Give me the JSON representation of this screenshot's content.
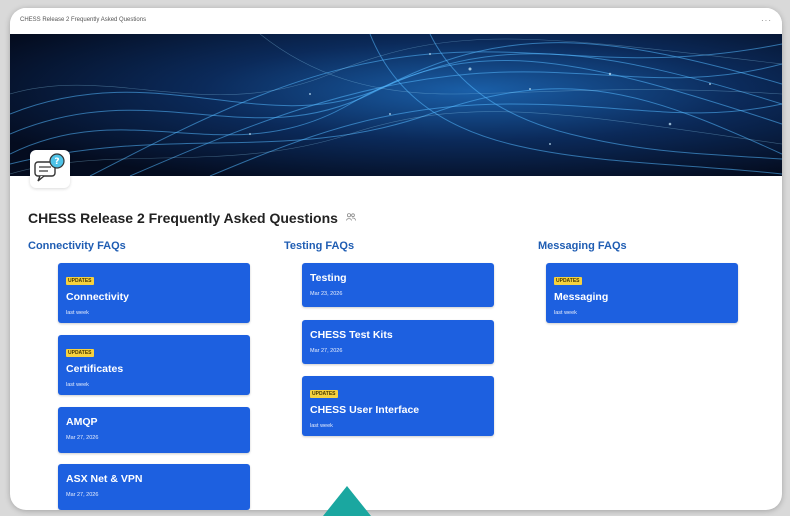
{
  "topbar": {
    "breadcrumb": "CHESS Release 2 Frequently Asked Questions",
    "more_label": "···"
  },
  "page": {
    "title": "CHESS Release 2 Frequently Asked Questions",
    "title_icon": "people-icon",
    "page_icon": "chat-question-icon"
  },
  "columns": [
    {
      "heading": "Connectivity FAQs",
      "cards": [
        {
          "badge": "UPDATES",
          "title": "Connectivity",
          "date": "last week"
        },
        {
          "badge": "UPDATES",
          "title": "Certificates",
          "date": "last week"
        },
        {
          "badge": "",
          "title": "AMQP",
          "date": "Mar 27, 2026"
        },
        {
          "badge": "",
          "title": "ASX Net & VPN",
          "date": "Mar 27, 2026"
        }
      ]
    },
    {
      "heading": "Testing FAQs",
      "cards": [
        {
          "badge": "",
          "title": "Testing",
          "date": "Mar 23, 2026"
        },
        {
          "badge": "",
          "title": "CHESS Test Kits",
          "date": "Mar 27, 2026"
        },
        {
          "badge": "UPDATES",
          "title": "CHESS User Interface",
          "date": "last week"
        }
      ]
    },
    {
      "heading": "Messaging FAQs",
      "cards": [
        {
          "badge": "UPDATES",
          "title": "Messaging",
          "date": "last week"
        }
      ]
    }
  ],
  "colors": {
    "card": "#1d60e0",
    "heading": "#1f5db3",
    "badge": "#f7d23e",
    "pointer": "#1aa7a0"
  }
}
